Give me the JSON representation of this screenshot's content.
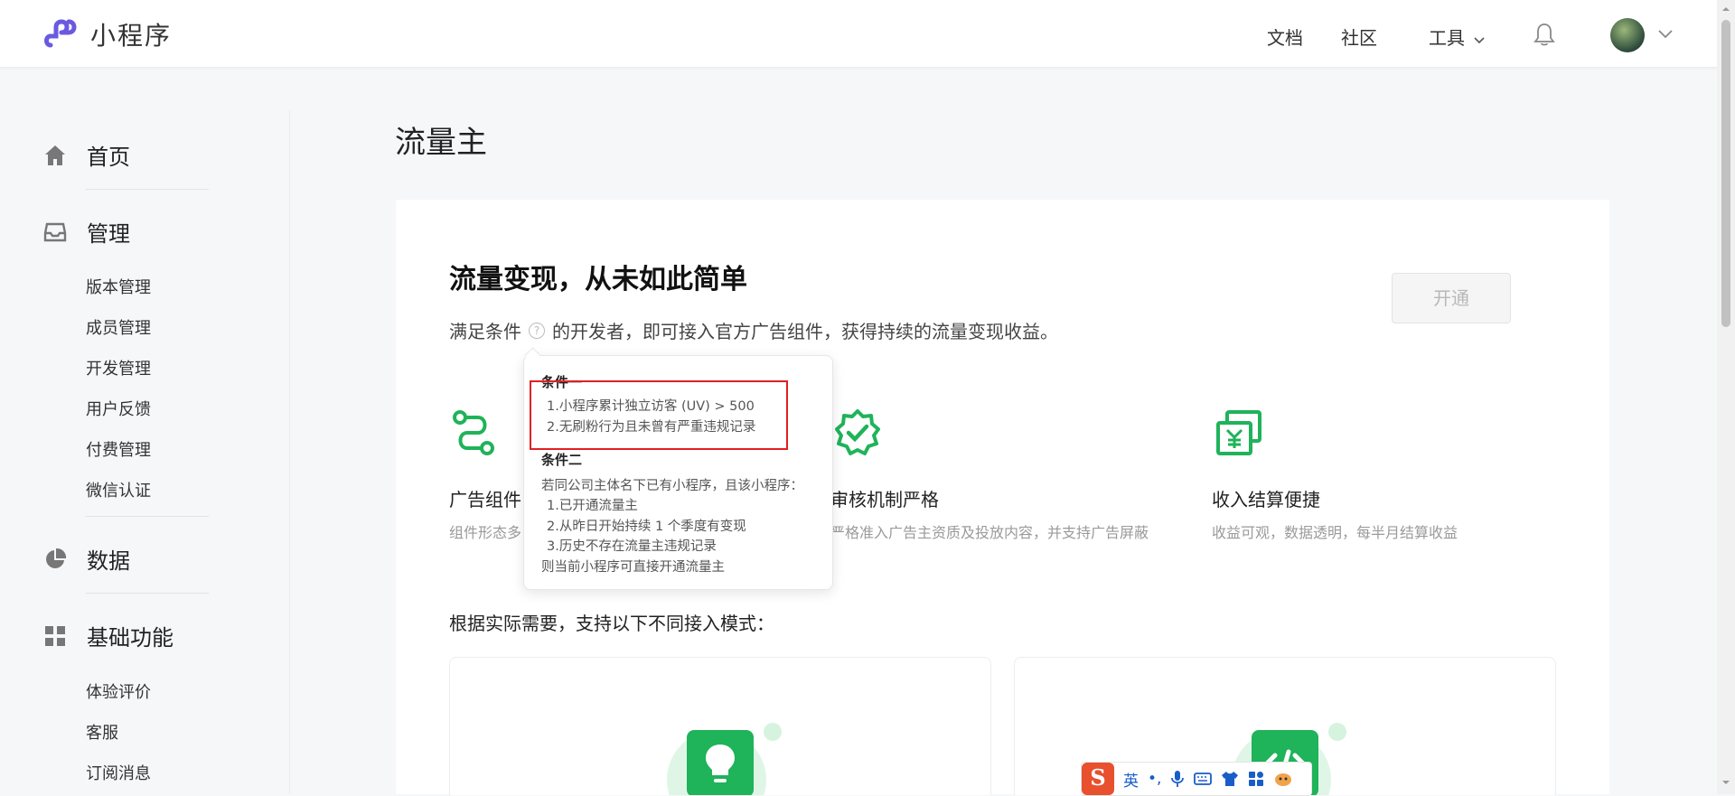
{
  "header": {
    "app_title": "小程序",
    "nav": {
      "docs": "文档",
      "community": "社区",
      "tools": "工具"
    }
  },
  "sidebar": {
    "home": "首页",
    "manage": "管理",
    "manage_items": [
      "版本管理",
      "成员管理",
      "开发管理",
      "用户反馈",
      "付费管理",
      "微信认证"
    ],
    "data": "数据",
    "basic": "基础功能",
    "basic_items": [
      "体验评价",
      "客服",
      "订阅消息"
    ]
  },
  "main": {
    "page_title": "流量主",
    "hero_title": "流量变现，从未如此简单",
    "hero_desc_before": "满足条件",
    "hero_desc_after": "的开发者，即可接入官方广告组件，获得持续的流量变现收益。",
    "open_button": "开通",
    "features": [
      {
        "title": "广告组件",
        "desc": "组件形态多"
      },
      {
        "title": "审核机制严格",
        "desc": "严格准入广告主资质及投放内容，并支持广告屏蔽"
      },
      {
        "title": "收入结算便捷",
        "desc": "收益可观，数据透明，每半月结算收益"
      }
    ],
    "modes_title": "根据实际需要，支持以下不同接入模式："
  },
  "tooltip": {
    "cond1_title": "条件一",
    "cond1_lines": [
      "1.小程序累计独立访客 (UV) > 500",
      "2.无刷粉行为且未曾有严重违规记录"
    ],
    "cond2_title": "条件二",
    "cond2_intro": "若同公司主体名下已有小程序，且该小程序：",
    "cond2_lines": [
      "1.已开通流量主",
      "2.从昨日开始持续 1 个季度有变现",
      "3.历史不存在流量主违规记录"
    ],
    "cond2_outro": "则当前小程序可直接开通流量主"
  },
  "ime": {
    "logo": "S",
    "lang": "英",
    "punct": "•,"
  },
  "colors": {
    "accent_green": "#1fb35a",
    "logo_purple": "#6c5ce7",
    "highlight_red": "#e02020"
  }
}
